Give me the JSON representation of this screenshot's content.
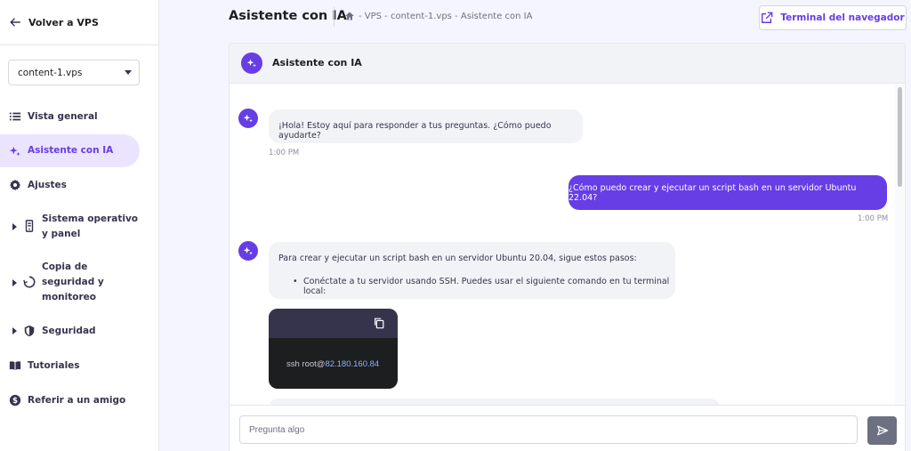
{
  "sidebar": {
    "back_label": "Volver a VPS",
    "server_select": "content-1.vps",
    "items": [
      {
        "label": "Vista general"
      },
      {
        "label": "Asistente con IA"
      },
      {
        "label": "Ajustes"
      },
      {
        "label_line1": "Sistema operativo",
        "label_line2": "y panel"
      },
      {
        "label_line1": "Copia de",
        "label_line2": "seguridad y",
        "label_line3": "monitoreo"
      },
      {
        "label": "Seguridad"
      },
      {
        "label": "Tutoriales"
      },
      {
        "label": "Referir a un amigo"
      }
    ]
  },
  "header": {
    "title": "Asistente con IA",
    "breadcrumb": "- VPS - content-1.vps - Asistente con IA",
    "terminal_button": "Terminal del navegador"
  },
  "chat": {
    "title": "Asistente con IA",
    "messages": [
      {
        "text": "¡Hola! Estoy aquí para responder a tus preguntas. ¿Cómo puedo ayudarte?",
        "time": "1:00 PM"
      },
      {
        "text": "¿Cómo puedo crear y ejecutar un script bash en un servidor Ubuntu 22.04?",
        "time": "1:00 PM"
      },
      {
        "intro": "Para crear y ejecutar un script bash en un servidor Ubuntu 20.04, sigue estos pasos:",
        "bullet": "Conéctate a tu servidor usando SSH. Puedes usar el siguiente comando en tu terminal local:"
      }
    ],
    "code": {
      "cmd": "ssh root@",
      "ip": "82.180.160.84"
    },
    "input_placeholder": "Pregunta algo"
  },
  "colors": {
    "accent": "#673de6",
    "active_bg": "#ebe4ff",
    "code_bg": "#1d1e20"
  }
}
